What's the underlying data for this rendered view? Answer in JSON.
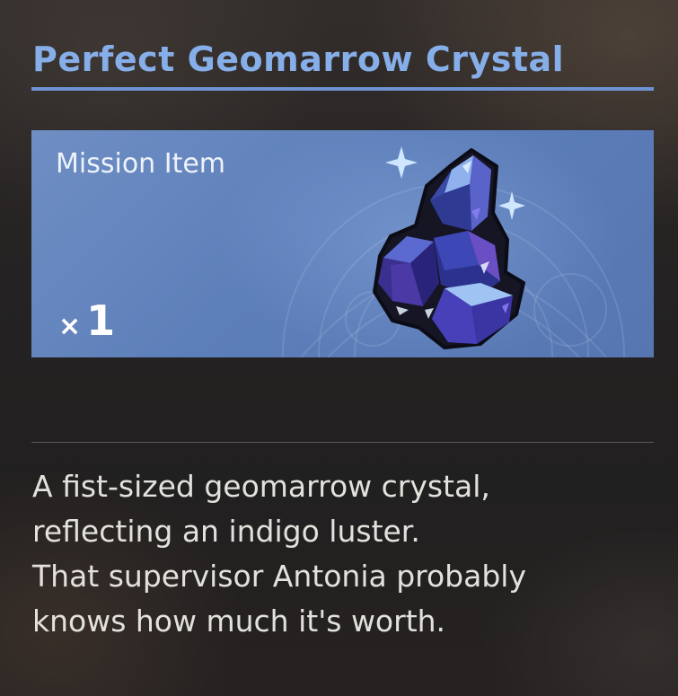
{
  "item": {
    "name": "Perfect Geomarrow Crystal",
    "type": "Mission Item",
    "quantity_prefix": "×",
    "quantity": "1",
    "image_icon": "crystal-icon"
  },
  "description": {
    "lines": [
      "A fist-sized geomarrow crystal,",
      "reflecting an indigo luster.",
      "That supervisor Antonia probably",
      "knows how much it's worth."
    ]
  },
  "colors": {
    "title": "#86aee8",
    "title_rule": "#6d93d2",
    "card": "#5f80bb",
    "text": "#e3e1dc"
  }
}
